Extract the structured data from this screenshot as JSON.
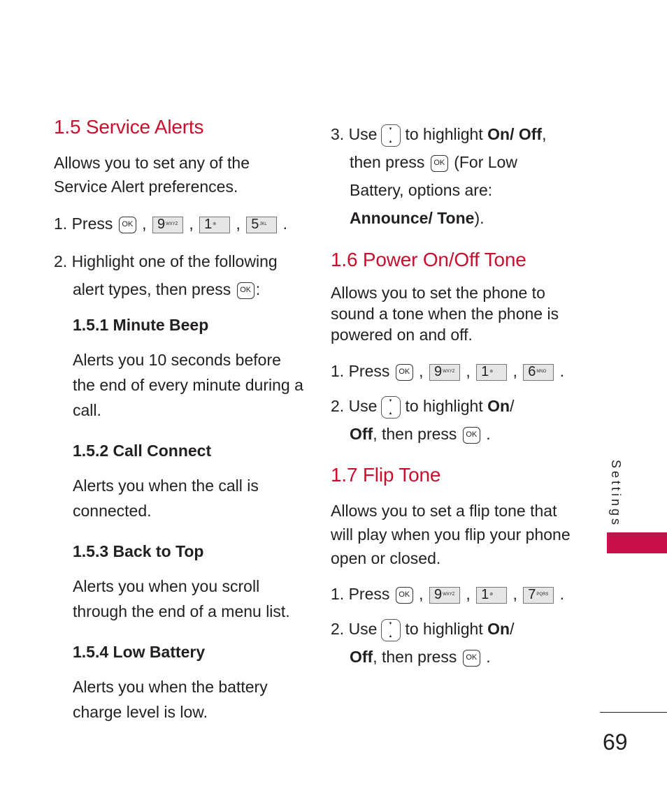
{
  "left": {
    "title": "1.5 Service Alerts",
    "intro": "Allows you to set any of the Service Alert preferences.",
    "step1": {
      "label": "1. Press",
      "keys": [
        "OK",
        "9",
        "1",
        "5"
      ],
      "key_letters": [
        "WXYZ",
        "",
        "JKL"
      ]
    },
    "step2": {
      "line1": "2. Highlight one of the following",
      "line2": "alert types, then press",
      "end": ":"
    },
    "subsections": [
      {
        "title": "1.5.1 Minute Beep",
        "desc": "Alerts you 10 seconds before the end of every minute during a call."
      },
      {
        "title": "1.5.2 Call Connect",
        "desc": "Alerts you when the call is connected."
      },
      {
        "title": "1.5.3 Back to Top",
        "desc": "Alerts you when you scroll through the end of a menu list."
      },
      {
        "title": "1.5.4 Low Battery",
        "desc": "Alerts you when the battery charge level is low."
      }
    ]
  },
  "right": {
    "step3": {
      "a": "3. Use",
      "b": "to highlight",
      "on": "On",
      "sep": "/ ",
      "off": "Off",
      "c": ",",
      "d": "then press",
      "e": "(For Low",
      "f": "Battery, options are:",
      "g": "Announce/ Tone",
      "h": ")."
    },
    "power": {
      "title": "1.6 Power On/Off Tone",
      "intro": "Allows you to set the phone to sound a tone when the phone is powered on and off.",
      "step1_label": "1. Press",
      "keys": [
        "OK",
        "9",
        "1",
        "6"
      ],
      "key_letters": [
        "WXYZ",
        "",
        "MNO"
      ],
      "step2_a": "2. Use",
      "step2_b": "to highlight",
      "on": "On",
      "slash": "/",
      "off": "Off",
      "then": ", then press",
      "dot": "."
    },
    "flip": {
      "title": "1.7 Flip Tone",
      "intro": "Allows you to set a flip tone that will play when you flip your phone open or closed.",
      "step1_label": "1. Press",
      "keys": [
        "OK",
        "9",
        "1",
        "7"
      ],
      "key_letters": [
        "WXYZ",
        "",
        "PQRS"
      ],
      "step2_a": "2. Use",
      "step2_b": "to highlight",
      "on": "On",
      "slash": "/",
      "off": "Off",
      "then": ", then press",
      "dot": "."
    }
  },
  "tab": {
    "label": "Settings",
    "color": "#c8104a"
  },
  "page_number": "69",
  "accent": "#c8102e"
}
